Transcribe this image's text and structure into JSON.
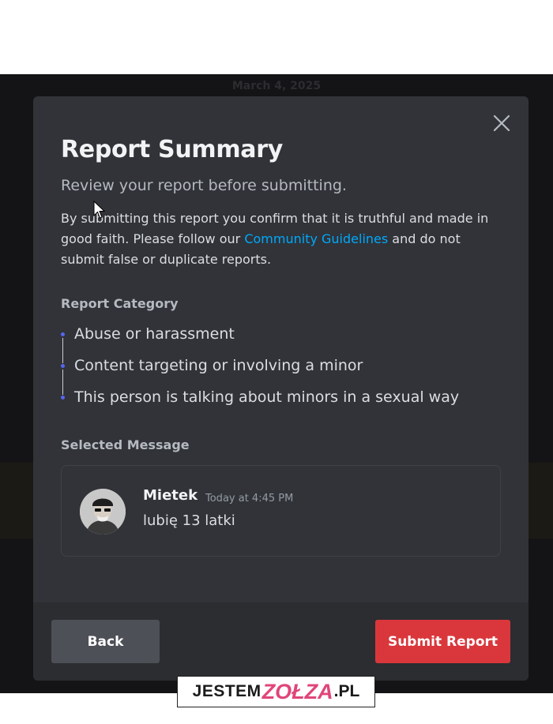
{
  "background": {
    "date_divider": "March 4, 2025"
  },
  "modal": {
    "title": "Report Summary",
    "subtitle": "Review your report before submitting.",
    "disclaimer": {
      "before_link": "By submitting this report you confirm that it is truthful and made in good faith. Please follow our ",
      "link_text": "Community Guidelines",
      "after_link": " and do not submit false or duplicate reports."
    },
    "category_label": "Report Category",
    "categories": [
      "Abuse or harassment",
      "Content targeting or involving a minor",
      "This person is talking about minors in a sexual way"
    ],
    "selected_message_label": "Selected Message",
    "message": {
      "author": "Mietek",
      "timestamp": "Today at 4:45 PM",
      "text": "lubię 13 latki"
    },
    "buttons": {
      "back": "Back",
      "submit": "Submit Report"
    },
    "close_icon": "close-icon"
  },
  "watermark": {
    "prefix": "JESTEM",
    "middle": "ZOŁZA",
    "suffix": ".PL"
  },
  "colors": {
    "modal_bg": "#313338",
    "footer_bg": "#2b2d31",
    "link": "#00a8fc",
    "submit": "#da373c",
    "back": "#4e5058",
    "bullet": "#5865f2"
  }
}
